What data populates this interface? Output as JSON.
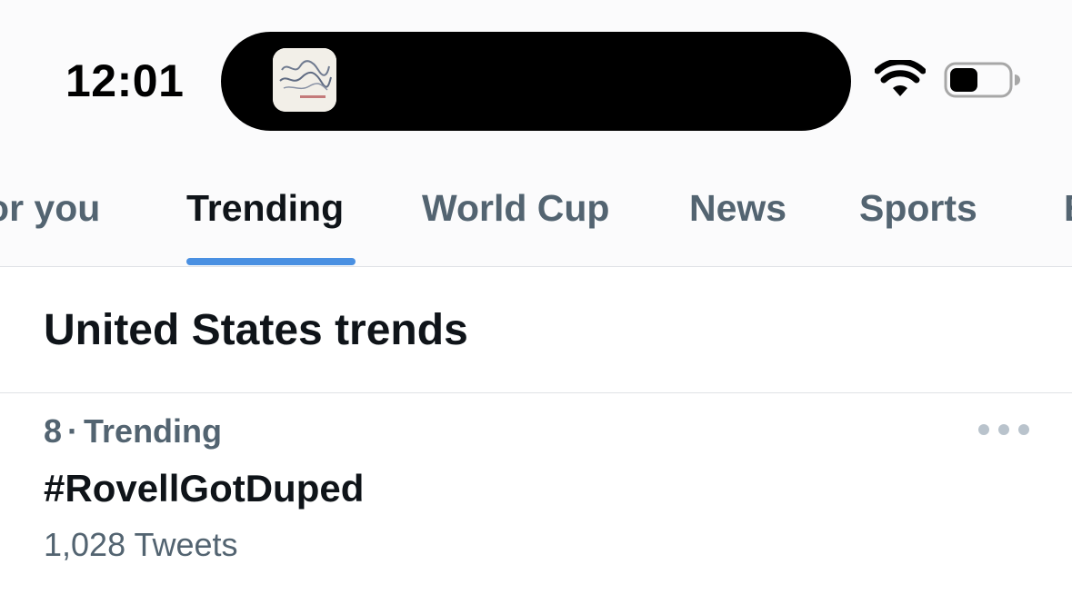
{
  "status_bar": {
    "time": "12:01",
    "icons": [
      "app-icon",
      "wifi-icon",
      "battery-icon"
    ]
  },
  "tabs": [
    {
      "label": "For you",
      "active": false
    },
    {
      "label": "Trending",
      "active": true
    },
    {
      "label": "World Cup",
      "active": false
    },
    {
      "label": "News",
      "active": false
    },
    {
      "label": "Sports",
      "active": false
    },
    {
      "label": "E",
      "active": false
    }
  ],
  "section": {
    "title": "United States trends"
  },
  "trends": [
    {
      "rank": "8",
      "separator": "·",
      "context": "Trending",
      "name": "#RovellGotDuped",
      "count": "1,028 Tweets",
      "more_icon": "more-horizontal-icon"
    }
  ],
  "colors": {
    "accent": "#4a90e2",
    "text_primary": "#0f1419",
    "text_secondary": "#536471",
    "divider": "#dfe2e6"
  }
}
